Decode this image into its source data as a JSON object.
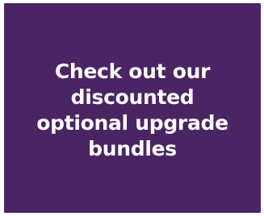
{
  "promo": {
    "message": "Check out our discounted optional upgrade bundles",
    "background_color": "#4b2463",
    "text_color": "#ffffff"
  }
}
